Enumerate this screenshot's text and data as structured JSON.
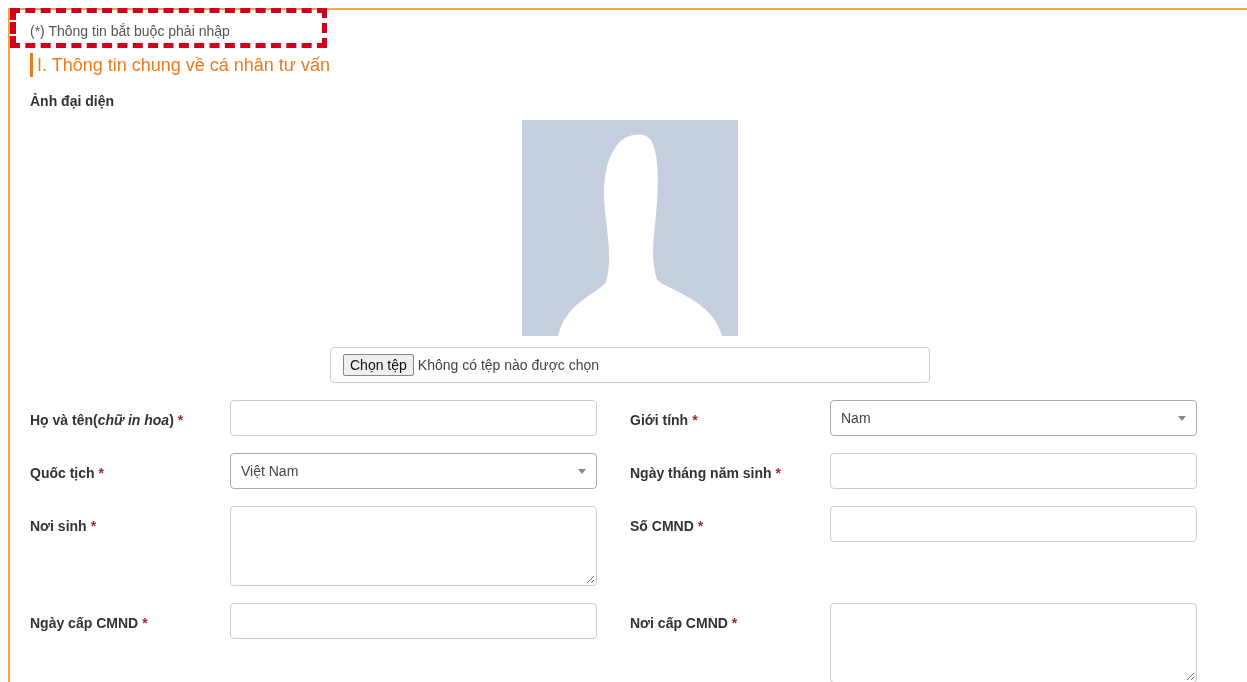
{
  "highlight_frame": true,
  "required_note": "(*) Thông tin bắt buộc phải nhập",
  "section_title": "I. Thông tin chung về cá nhân tư vấn",
  "avatar": {
    "label": "Ảnh đại diện",
    "button": "Chọn tệp",
    "file_status": "Không có tệp nào được chọn"
  },
  "rows": [
    [
      {
        "label": "Họ và tên(*chữ in hoa*)",
        "required_mark": "*",
        "kind": "text"
      },
      {
        "label": "Giới tính",
        "required_mark": "*",
        "kind": "select",
        "value": "Nam"
      }
    ],
    [
      {
        "label": "Quốc tịch",
        "required_mark": "*",
        "kind": "select",
        "value": "Việt Nam"
      },
      {
        "label": "Ngày tháng năm sinh",
        "required_mark": "*",
        "kind": "text"
      }
    ],
    [
      {
        "label": "Nơi sinh",
        "required_mark": "*",
        "kind": "textarea"
      },
      {
        "label": "Số CMND",
        "required_mark": "*",
        "kind": "text"
      }
    ],
    [
      {
        "label": "Ngày cấp CMND",
        "required_mark": "*",
        "kind": "text"
      },
      {
        "label": "Nơi cấp CMND",
        "required_mark": "*",
        "kind": "textarea"
      }
    ]
  ]
}
